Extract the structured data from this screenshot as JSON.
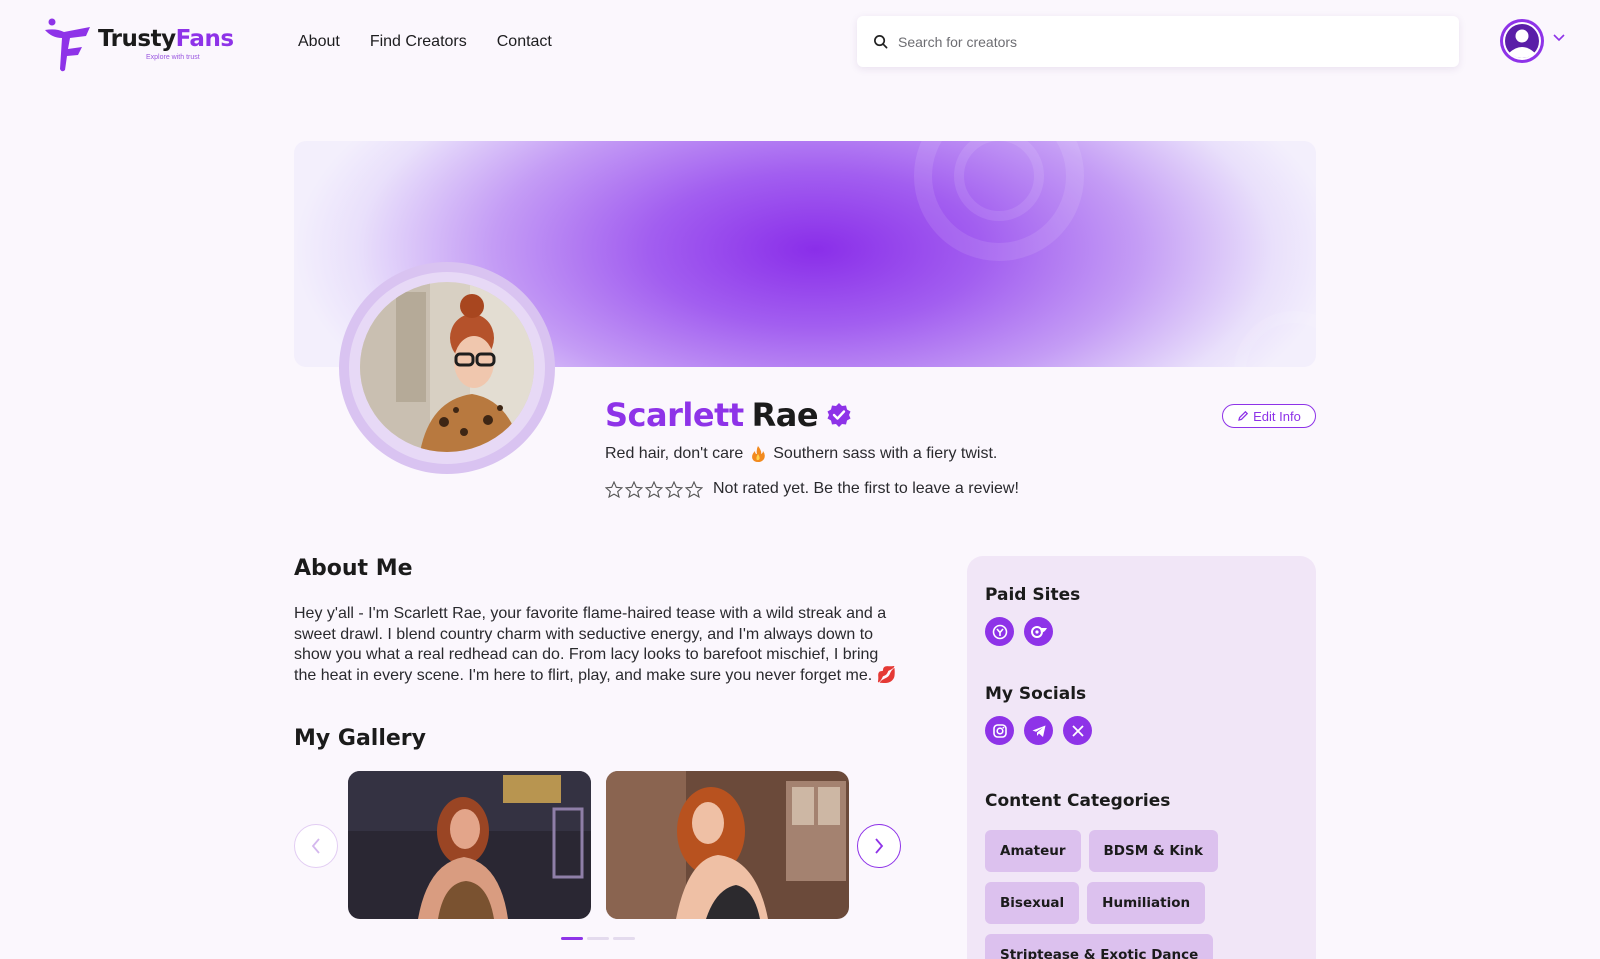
{
  "header": {
    "brand_first": "Trusty",
    "brand_second": "Fans",
    "brand_tagline": "Explore with trust",
    "nav": [
      "About",
      "Find Creators",
      "Contact"
    ],
    "search_placeholder": "Search for creators"
  },
  "profile": {
    "first_name": "Scarlett",
    "last_name": "Rae",
    "edit_label": "Edit Info",
    "tagline_part1": "Red hair, don't care",
    "tagline_part2": "Southern sass with a fiery twist.",
    "rating_stars": 0,
    "rating_text": "Not rated yet. Be the first to leave a review!"
  },
  "about": {
    "heading": "About Me",
    "text": "Hey y'all - I'm Scarlett Rae, your favorite flame-haired tease with a wild streak and a sweet drawl. I blend country charm with seductive energy, and I'm always down to show you what a real redhead can do. From lacy looks to barefoot mischief, I bring the heat in every scene. I'm here to flirt, play, and make sure you never forget me. 💋"
  },
  "gallery": {
    "heading": "My Gallery",
    "images": [
      "gallery-photo-1",
      "gallery-photo-2"
    ],
    "active_page": 1,
    "page_count": 3
  },
  "sidebar": {
    "paid_sites_heading": "Paid Sites",
    "paid_sites": [
      "fansly-icon",
      "onlyfans-icon"
    ],
    "socials_heading": "My Socials",
    "socials": [
      "instagram-icon",
      "telegram-icon",
      "x-icon"
    ],
    "categories_heading": "Content Categories",
    "categories": [
      "Amateur",
      "BDSM & Kink",
      "Bisexual",
      "Humiliation",
      "Striptease & Exotic Dance"
    ]
  },
  "colors": {
    "accent": "#8e33e8",
    "background": "#fbf7fd",
    "sidebar_bg": "#f1e6f7",
    "chip_bg": "#dcc1ee"
  }
}
